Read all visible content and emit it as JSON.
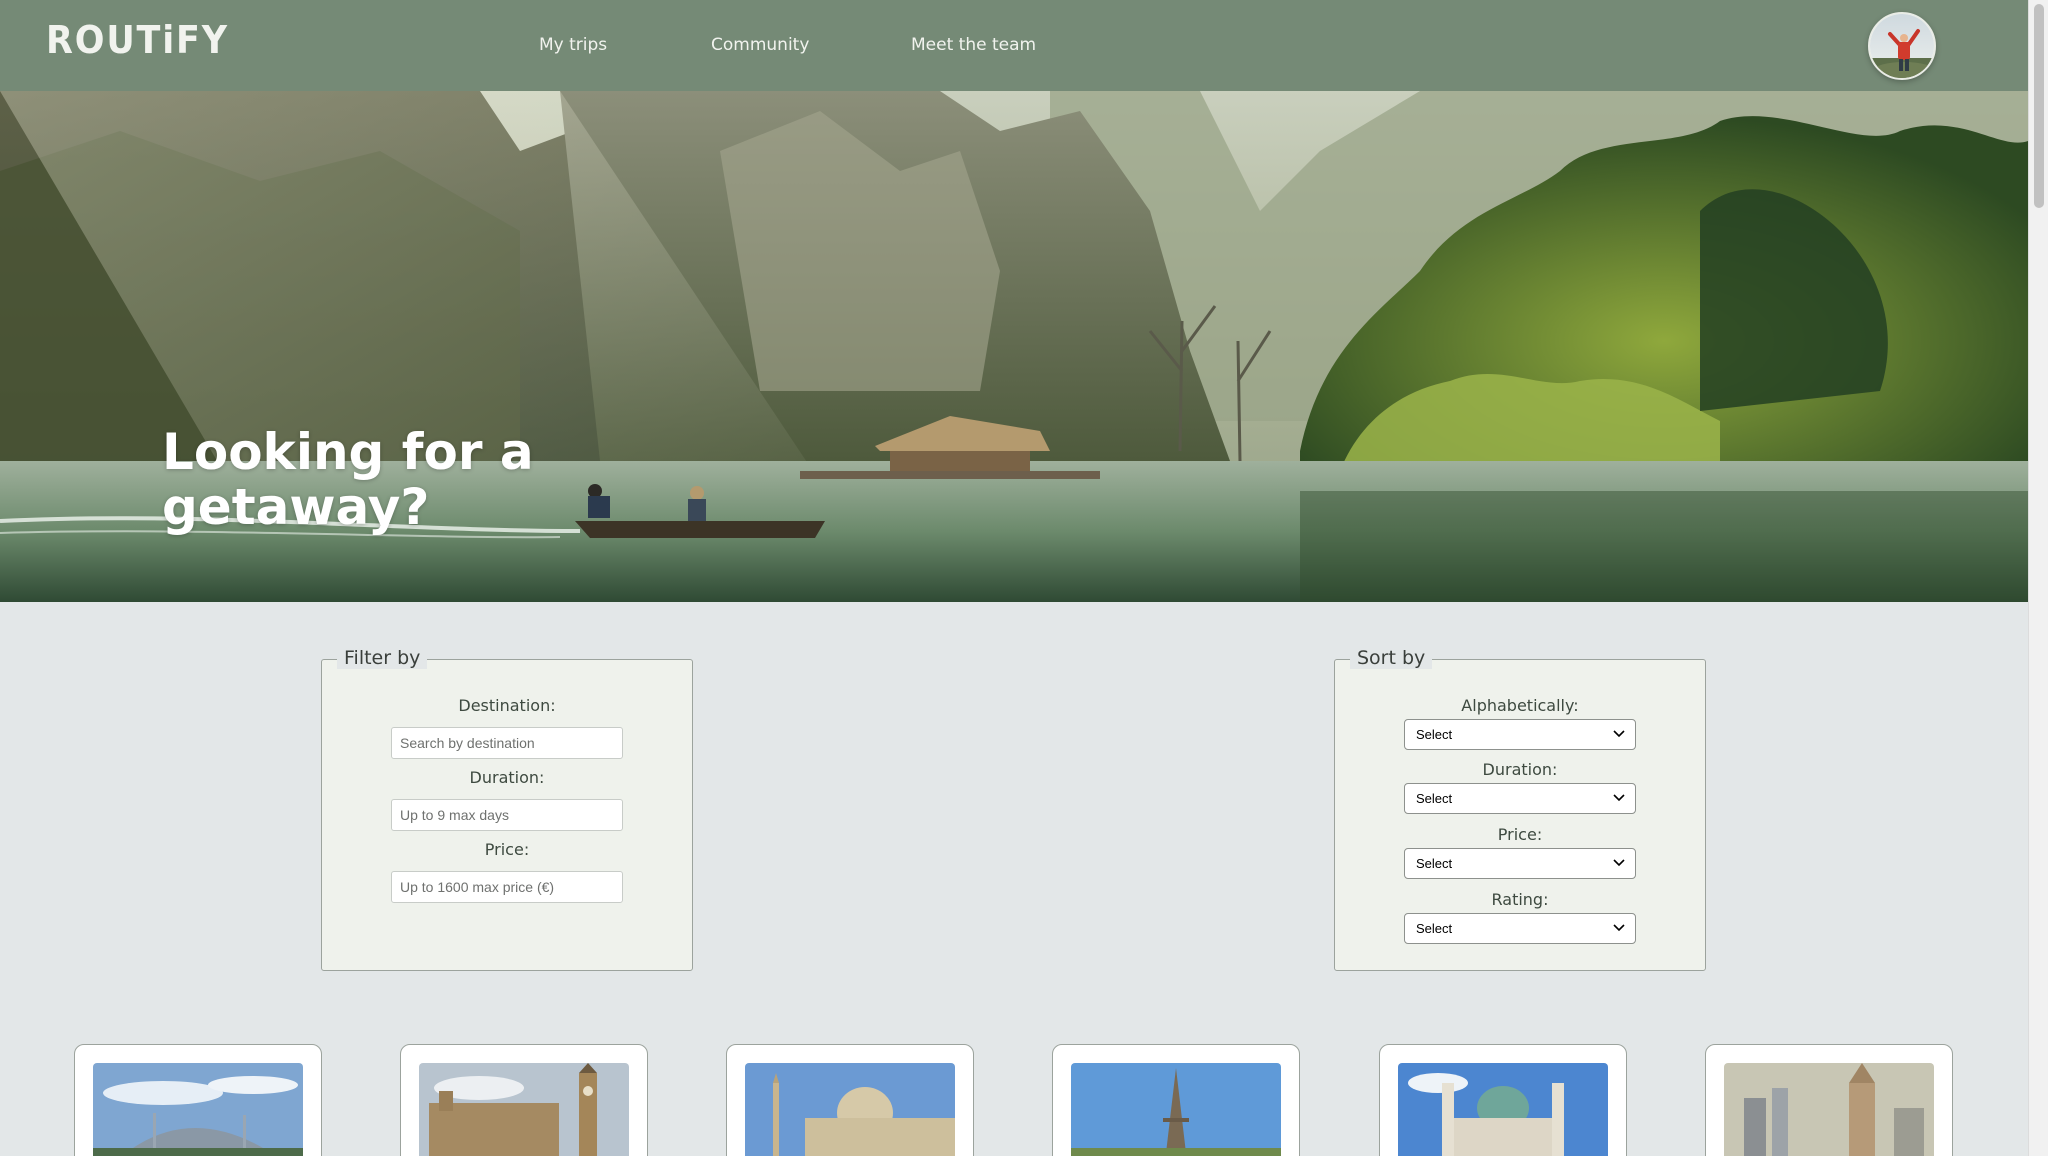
{
  "brand": {
    "logo": "ROUTiFY"
  },
  "nav": {
    "items": [
      "My trips",
      "Community",
      "Meet the team"
    ]
  },
  "hero": {
    "title": "Looking for a getaway?"
  },
  "filter": {
    "legend": "Filter by",
    "destination_label": "Destination:",
    "destination_placeholder": "Search by destination",
    "duration_label": "Duration:",
    "duration_placeholder": "Up to 9 max days",
    "price_label": "Price:",
    "price_placeholder": "Up to 1600 max price (€)"
  },
  "sort": {
    "legend": "Sort by",
    "alphabetically_label": "Alphabetically:",
    "duration_label": "Duration:",
    "price_label": "Price:",
    "rating_label": "Rating:",
    "select_value": "Select"
  },
  "cards": [
    {
      "image": "istanbul-mosque-image"
    },
    {
      "image": "london-parliament-image"
    },
    {
      "image": "rome-vatican-image"
    },
    {
      "image": "paris-eiffel-image"
    },
    {
      "image": "vienna-karlskirche-image"
    },
    {
      "image": "warsaw-skyline-image"
    }
  ],
  "colors": {
    "nav_bg": "#758a76",
    "page_bg": "#e3e7e8",
    "panel_bg": "#eff2ec"
  }
}
